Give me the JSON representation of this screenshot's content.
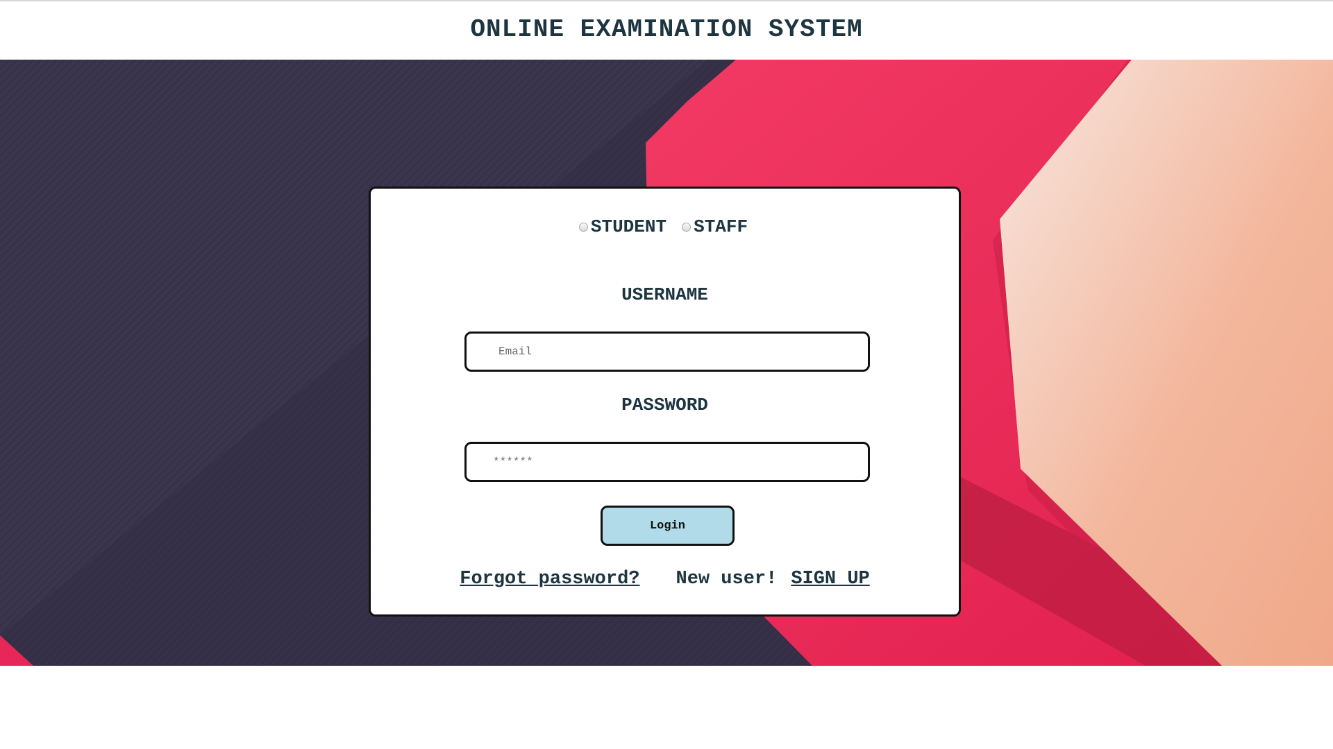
{
  "header": {
    "title": "ONLINE EXAMINATION SYSTEM"
  },
  "login": {
    "roles": [
      {
        "label": "STUDENT",
        "selected": false
      },
      {
        "label": "STAFF",
        "selected": false
      }
    ],
    "username_label": "USERNAME",
    "username_placeholder": "Email",
    "password_label": "PASSWORD",
    "password_placeholder": "******",
    "login_button": "Login",
    "forgot_link": "Forgot password?",
    "new_user_text": "New user!",
    "signup_link": "SIGN UP"
  },
  "colors": {
    "text": "#1d3540",
    "background_dark": "#3a344c",
    "background_red": "#e92a57",
    "background_peach": "#f2b49a",
    "login_button": "#b1dbe8"
  }
}
